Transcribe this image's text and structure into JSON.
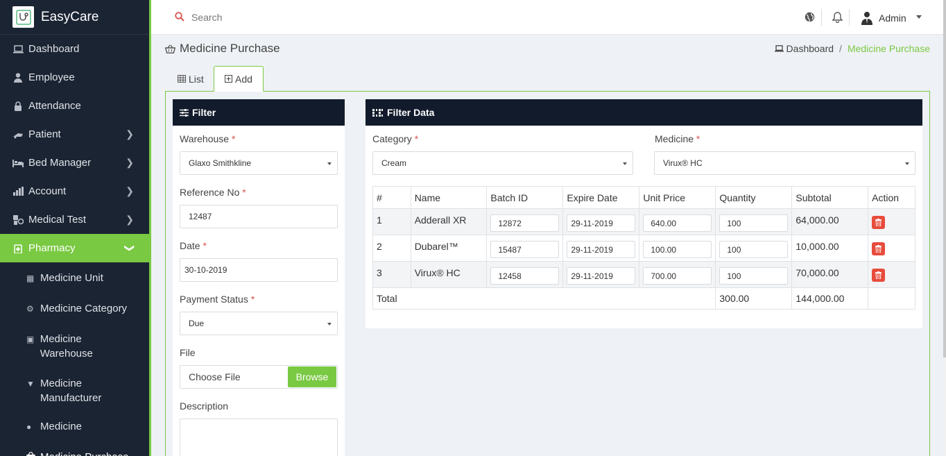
{
  "app": {
    "name": "EasyCare"
  },
  "sidebar": {
    "items": [
      {
        "label": "Dashboard",
        "icon": "laptop-icon",
        "has_children": false
      },
      {
        "label": "Employee",
        "icon": "user-icon",
        "has_children": false
      },
      {
        "label": "Attendance",
        "icon": "lock-icon",
        "has_children": false
      },
      {
        "label": "Patient",
        "icon": "wheelchair-icon",
        "has_children": true
      },
      {
        "label": "Bed Manager",
        "icon": "bed-icon",
        "has_children": true
      },
      {
        "label": "Account",
        "icon": "chart-icon",
        "has_children": true
      },
      {
        "label": "Medical Test",
        "icon": "test-icon",
        "has_children": true
      },
      {
        "label": "Pharmacy",
        "icon": "pharmacy-icon",
        "has_children": true,
        "active": true
      }
    ],
    "pharmacy_sub": [
      {
        "label": "Medicine Unit",
        "icon": "unit-icon"
      },
      {
        "label": "Medicine Category",
        "icon": "category-icon"
      },
      {
        "label": "Medicine Warehouse",
        "icon": "warehouse-icon"
      },
      {
        "label_line1": "Medicine",
        "label_line2": "Manufacturer",
        "icon": "mortar-icon"
      },
      {
        "label": "Medicine",
        "icon": "pills-icon"
      },
      {
        "label": "Medicine Purchase",
        "icon": "basket-icon",
        "current": true
      }
    ]
  },
  "topbar": {
    "search_placeholder": "Search",
    "user": "Admin"
  },
  "page": {
    "title": "Medicine Purchase",
    "breadcrumb": {
      "home": "Dashboard",
      "separator": "/",
      "current": "Medicine Purchase"
    },
    "tabs": {
      "list": "List",
      "add": "Add"
    }
  },
  "filter": {
    "title": "Filter",
    "warehouse_label": "Warehouse",
    "warehouse_value": "Glaxo Smithkline",
    "reference_label": "Reference No",
    "reference_value": "12487",
    "date_label": "Date",
    "date_value": "30-10-2019",
    "payment_label": "Payment Status",
    "payment_value": "Due",
    "file_label": "File",
    "file_placeholder": "Choose File",
    "browse_label": "Browse",
    "description_label": "Description",
    "required_mark": "*"
  },
  "filter_data": {
    "title": "Filter Data",
    "category_label": "Category",
    "category_value": "Cream",
    "medicine_label": "Medicine",
    "medicine_value": "Virux® HC",
    "columns": [
      "#",
      "Name",
      "Batch ID",
      "Expire Date",
      "Unit Price",
      "Quantity",
      "Subtotal",
      "Action"
    ],
    "rows": [
      {
        "no": "1",
        "name": "Adderall XR",
        "batch": "12872",
        "expire": "29-11-2019",
        "price": "640.00",
        "qty": "100",
        "subtotal": "64,000.00"
      },
      {
        "no": "2",
        "name": "Dubarel™",
        "batch": "15487",
        "expire": "29-11-2019",
        "price": "100.00",
        "qty": "100",
        "subtotal": "10,000.00"
      },
      {
        "no": "3",
        "name": "Virux® HC",
        "batch": "12458",
        "expire": "29-11-2019",
        "price": "700.00",
        "qty": "100",
        "subtotal": "70,000.00"
      }
    ],
    "total_label": "Total",
    "total_qty": "300.00",
    "total_amount": "144,000.00"
  },
  "colors": {
    "accent": "#7ac943",
    "sidebar_bg": "#1b2433",
    "card_header": "#111b2b",
    "danger": "#e74c3c"
  }
}
